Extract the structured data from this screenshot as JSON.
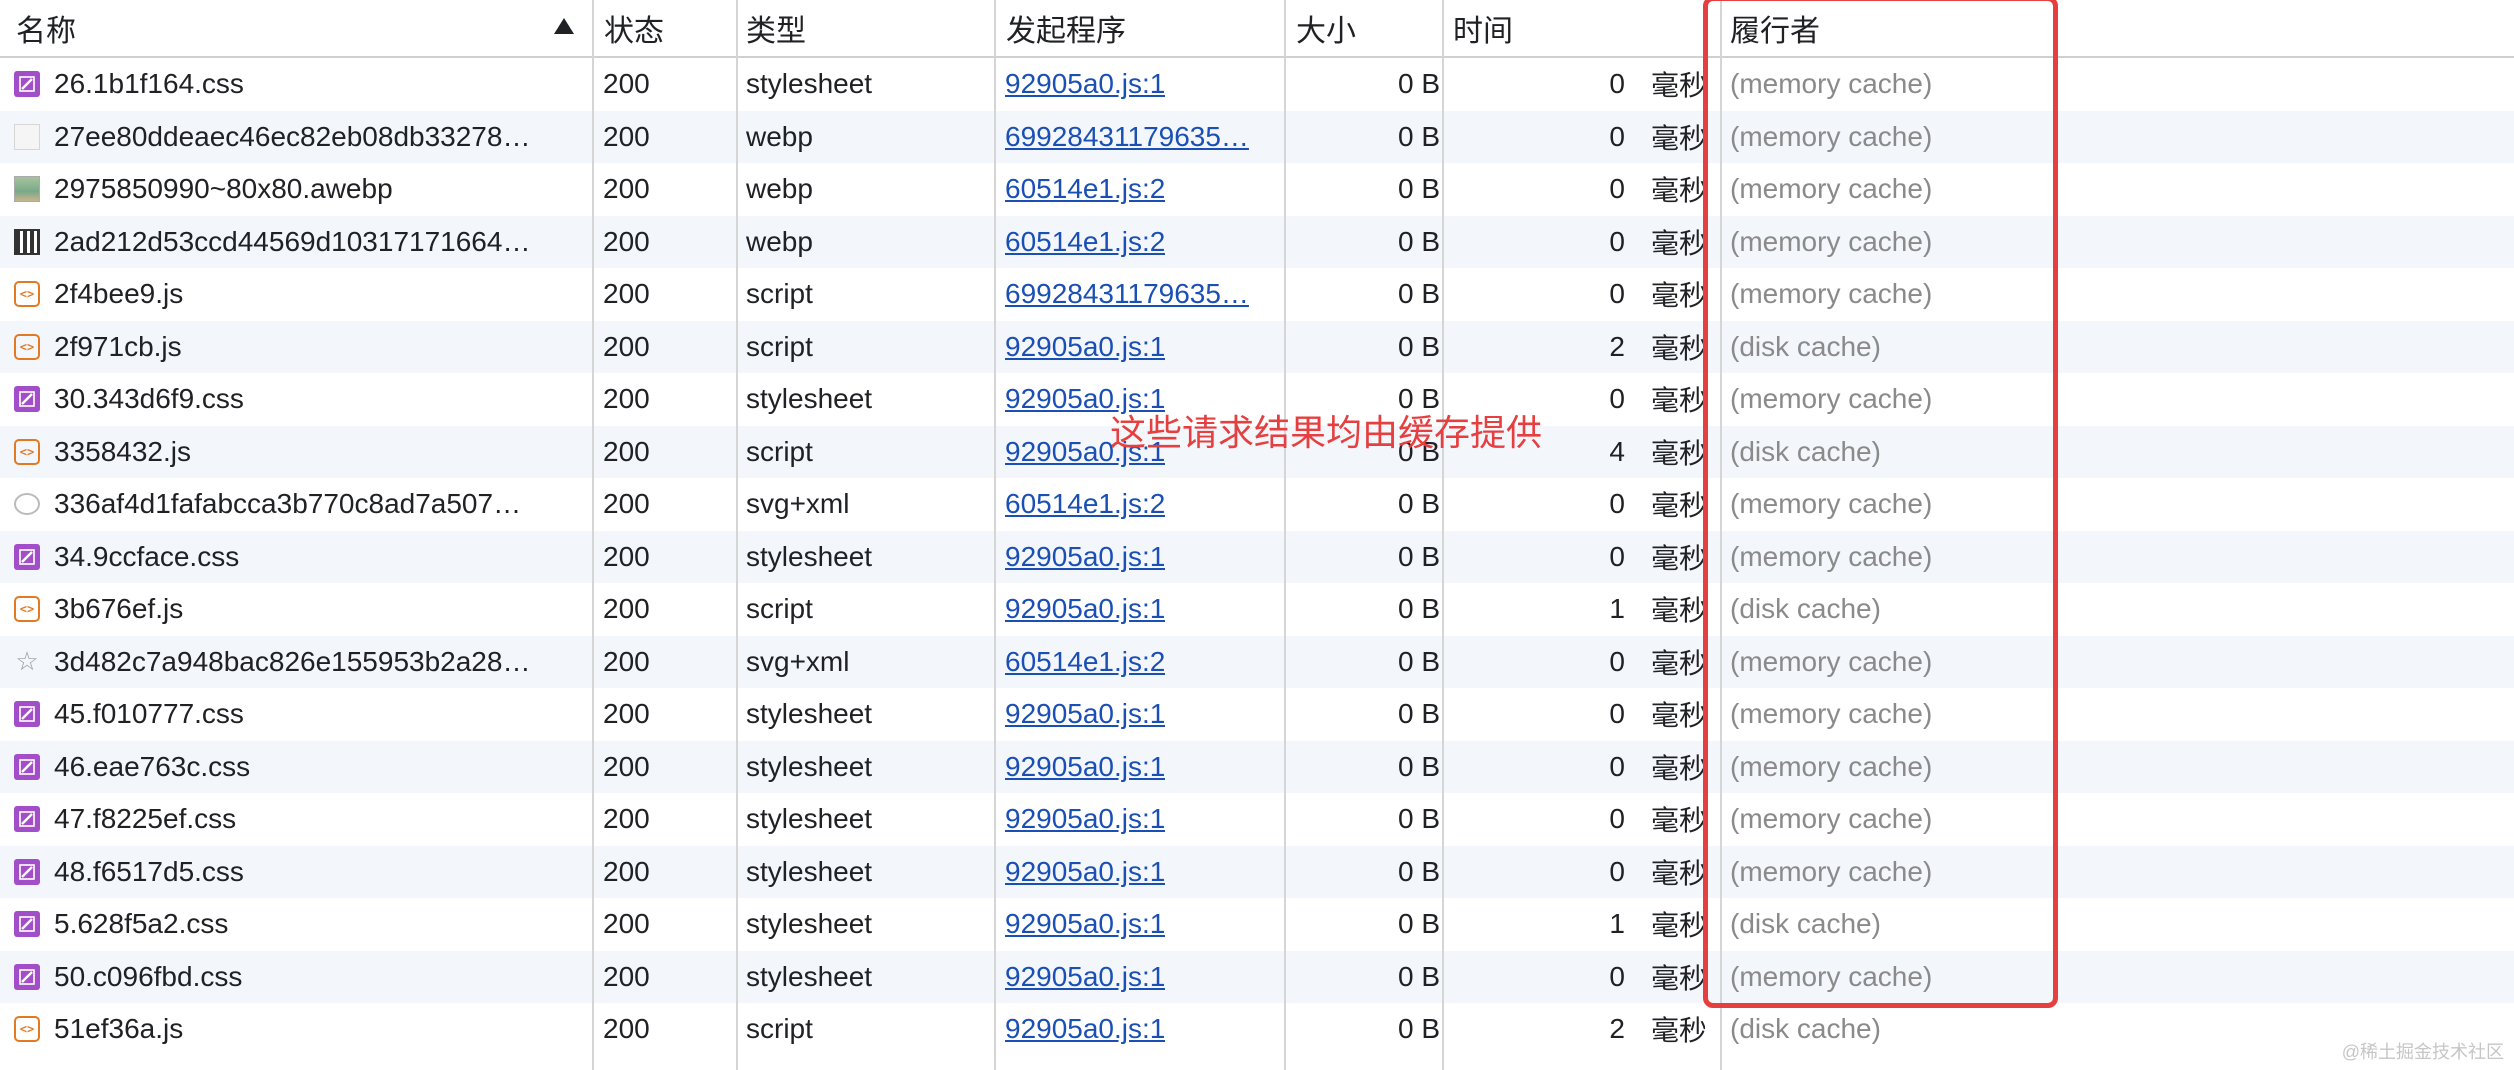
{
  "columns": {
    "name": "名称",
    "status": "状态",
    "type": "类型",
    "initiator": "发起程序",
    "size": "大小",
    "time": "时间",
    "fulfilled_by": "履行者"
  },
  "rows": [
    {
      "icon": "css-file-icon",
      "name": "26.1b1f164.css",
      "status": "200",
      "type": "stylesheet",
      "initiator": "92905a0.js:1",
      "size": "0 B",
      "time": "0",
      "unit": "毫秒",
      "fulfilled_by": "(memory cache)"
    },
    {
      "icon": "image-file-icon",
      "name": "27ee80ddeaec46ec82eb08db33278…",
      "status": "200",
      "type": "webp",
      "initiator": "69928431179635…",
      "size": "0 B",
      "time": "0",
      "unit": "毫秒",
      "fulfilled_by": "(memory cache)"
    },
    {
      "icon": "photo-thumbnail-icon",
      "name": "2975850990~80x80.awebp",
      "status": "200",
      "type": "webp",
      "initiator": "60514e1.js:2",
      "size": "0 B",
      "time": "0",
      "unit": "毫秒",
      "fulfilled_by": "(memory cache)"
    },
    {
      "icon": "qr-thumbnail-icon",
      "name": "2ad212d53ccd44569d10317171664…",
      "status": "200",
      "type": "webp",
      "initiator": "60514e1.js:2",
      "size": "0 B",
      "time": "0",
      "unit": "毫秒",
      "fulfilled_by": "(memory cache)"
    },
    {
      "icon": "js-file-icon",
      "name": "2f4bee9.js",
      "status": "200",
      "type": "script",
      "initiator": "69928431179635…",
      "size": "0 B",
      "time": "0",
      "unit": "毫秒",
      "fulfilled_by": "(memory cache)"
    },
    {
      "icon": "js-file-icon",
      "name": "2f971cb.js",
      "status": "200",
      "type": "script",
      "initiator": "92905a0.js:1",
      "size": "0 B",
      "time": "2",
      "unit": "毫秒",
      "fulfilled_by": "(disk cache)"
    },
    {
      "icon": "css-file-icon",
      "name": "30.343d6f9.css",
      "status": "200",
      "type": "stylesheet",
      "initiator": "92905a0.js:1",
      "size": "0 B",
      "time": "0",
      "unit": "毫秒",
      "fulfilled_by": "(memory cache)"
    },
    {
      "icon": "js-file-icon",
      "name": "3358432.js",
      "status": "200",
      "type": "script",
      "initiator": "92905a0.js:1",
      "size": "0 B",
      "time": "4",
      "unit": "毫秒",
      "fulfilled_by": "(disk cache)"
    },
    {
      "icon": "svg-circle-icon",
      "name": "336af4d1fafabcca3b770c8ad7a507…",
      "status": "200",
      "type": "svg+xml",
      "initiator": "60514e1.js:2",
      "size": "0 B",
      "time": "0",
      "unit": "毫秒",
      "fulfilled_by": "(memory cache)"
    },
    {
      "icon": "css-file-icon",
      "name": "34.9ccface.css",
      "status": "200",
      "type": "stylesheet",
      "initiator": "92905a0.js:1",
      "size": "0 B",
      "time": "0",
      "unit": "毫秒",
      "fulfilled_by": "(memory cache)"
    },
    {
      "icon": "js-file-icon",
      "name": "3b676ef.js",
      "status": "200",
      "type": "script",
      "initiator": "92905a0.js:1",
      "size": "0 B",
      "time": "1",
      "unit": "毫秒",
      "fulfilled_by": "(disk cache)"
    },
    {
      "icon": "svg-star-icon",
      "name": "3d482c7a948bac826e155953b2a28…",
      "status": "200",
      "type": "svg+xml",
      "initiator": "60514e1.js:2",
      "size": "0 B",
      "time": "0",
      "unit": "毫秒",
      "fulfilled_by": "(memory cache)"
    },
    {
      "icon": "css-file-icon",
      "name": "45.f010777.css",
      "status": "200",
      "type": "stylesheet",
      "initiator": "92905a0.js:1",
      "size": "0 B",
      "time": "0",
      "unit": "毫秒",
      "fulfilled_by": "(memory cache)"
    },
    {
      "icon": "css-file-icon",
      "name": "46.eae763c.css",
      "status": "200",
      "type": "stylesheet",
      "initiator": "92905a0.js:1",
      "size": "0 B",
      "time": "0",
      "unit": "毫秒",
      "fulfilled_by": "(memory cache)"
    },
    {
      "icon": "css-file-icon",
      "name": "47.f8225ef.css",
      "status": "200",
      "type": "stylesheet",
      "initiator": "92905a0.js:1",
      "size": "0 B",
      "time": "0",
      "unit": "毫秒",
      "fulfilled_by": "(memory cache)"
    },
    {
      "icon": "css-file-icon",
      "name": "48.f6517d5.css",
      "status": "200",
      "type": "stylesheet",
      "initiator": "92905a0.js:1",
      "size": "0 B",
      "time": "0",
      "unit": "毫秒",
      "fulfilled_by": "(memory cache)"
    },
    {
      "icon": "css-file-icon",
      "name": "5.628f5a2.css",
      "status": "200",
      "type": "stylesheet",
      "initiator": "92905a0.js:1",
      "size": "0 B",
      "time": "1",
      "unit": "毫秒",
      "fulfilled_by": "(disk cache)"
    },
    {
      "icon": "css-file-icon",
      "name": "50.c096fbd.css",
      "status": "200",
      "type": "stylesheet",
      "initiator": "92905a0.js:1",
      "size": "0 B",
      "time": "0",
      "unit": "毫秒",
      "fulfilled_by": "(memory cache)"
    },
    {
      "icon": "js-file-icon",
      "name": "51ef36a.js",
      "status": "200",
      "type": "script",
      "initiator": "92905a0.js:1",
      "size": "0 B",
      "time": "2",
      "unit": "毫秒",
      "fulfilled_by": "(disk cache)"
    }
  ],
  "annotation": "这些请求结果均由缓存提供",
  "watermark": "@稀土掘金技术社区",
  "colors": {
    "annotation": "#e53f3f",
    "link": "#1a4fb5",
    "css_icon": "#a24ec8",
    "js_icon": "#e27a24",
    "row_stripe": "#f3f6fb"
  }
}
